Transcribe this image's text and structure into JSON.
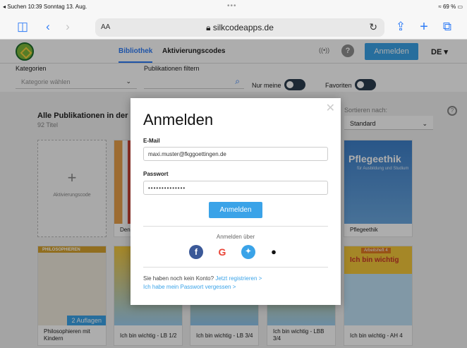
{
  "status": {
    "back_label": "◂ Suchen",
    "time": "10:39",
    "date": "Sonntag 13. Aug.",
    "battery": "69 %"
  },
  "browser": {
    "aa": "AA",
    "url": "silkcodeapps.de"
  },
  "header": {
    "nav": [
      "Bibliothek",
      "Aktivierungscodes"
    ],
    "login": "Anmelden",
    "lang": "DE"
  },
  "filters": {
    "categories_label": "Kategorien",
    "categories_placeholder": "Kategorie wählen",
    "pub_filter_label": "Publikationen filtern",
    "only_mine": "Nur meine",
    "favorites": "Favoriten"
  },
  "content": {
    "section_title": "Alle Publikationen in der Bibl",
    "count": "92 Titel",
    "sort_label": "Sortieren nach:",
    "sort_value": "Standard",
    "activation_code": "Aktivierungscode",
    "cards_row1": [
      {
        "title": "Den"
      },
      {
        "title": "Pflegeethik",
        "cover": "Pflegeethik",
        "subtitle": "für Ausbildung und Studium"
      }
    ],
    "cards_row2": [
      {
        "title": "Philosophieren mit Kindern",
        "badge": "2 Auflagen",
        "cover": "PHILOSOPHIEREN"
      },
      {
        "title": "Ich bin wichtig - LB 1/2"
      },
      {
        "title": "Ich bin wichtig - LB 3/4"
      },
      {
        "title": "Ich bin wichtig - LBB 3/4"
      },
      {
        "title": "Ich bin wichtig - AH 4",
        "cover": "Ich bin wichtig",
        "cover_tag": "Arbeitsheft 4"
      }
    ]
  },
  "modal": {
    "title": "Anmelden",
    "email_label": "E-Mail",
    "email_value": "maxi.muster@fkggoettingen.de",
    "password_label": "Passwort",
    "password_value": "••••••••••••••",
    "submit": "Anmelden",
    "via": "Anmelden über",
    "no_account": "Sie haben noch kein Konto?",
    "register": "Jetzt registrieren >",
    "forgot": "Ich habe mein Passwort vergessen >"
  }
}
